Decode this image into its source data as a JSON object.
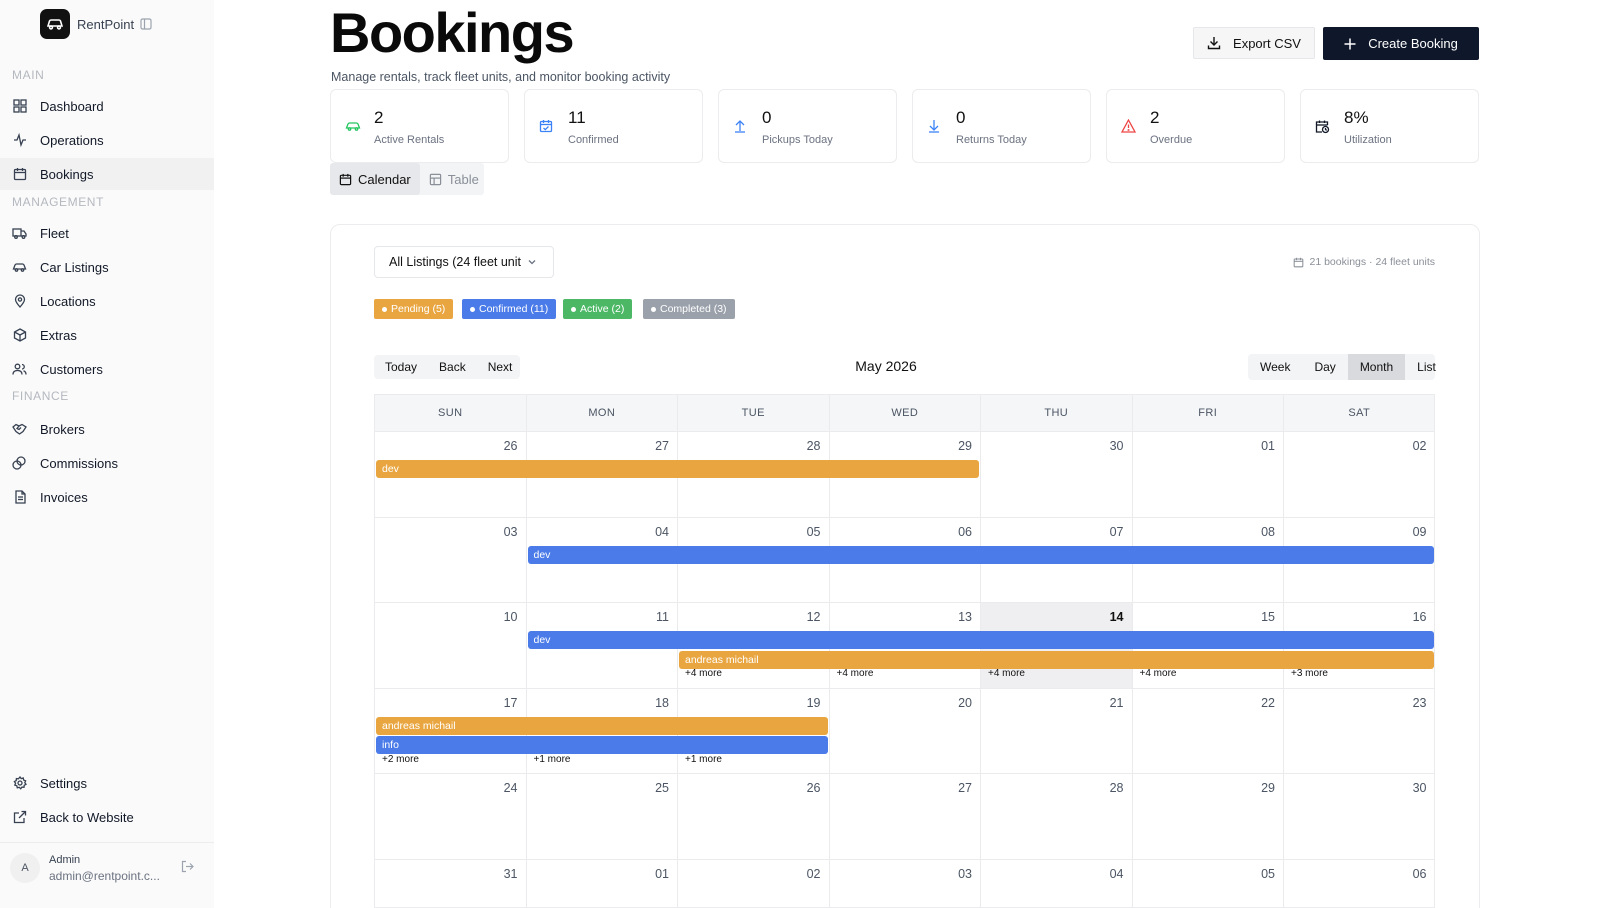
{
  "sidebar": {
    "brand": "RentPoint",
    "sections": {
      "main": "MAIN",
      "management": "MANAGEMENT",
      "finance": "FINANCE"
    },
    "items": [
      {
        "label": "Dashboard",
        "icon": "grid-icon"
      },
      {
        "label": "Operations",
        "icon": "activity-icon"
      },
      {
        "label": "Bookings",
        "icon": "calendar-icon"
      },
      {
        "label": "Fleet",
        "icon": "truck-icon"
      },
      {
        "label": "Car Listings",
        "icon": "car-icon"
      },
      {
        "label": "Locations",
        "icon": "map-pin-icon"
      },
      {
        "label": "Extras",
        "icon": "package-icon"
      },
      {
        "label": "Customers",
        "icon": "users-icon"
      },
      {
        "label": "Brokers",
        "icon": "handshake-icon"
      },
      {
        "label": "Commissions",
        "icon": "coins-icon"
      },
      {
        "label": "Invoices",
        "icon": "file-icon"
      },
      {
        "label": "Settings",
        "icon": "gear-icon"
      },
      {
        "label": "Back to Website",
        "icon": "external-link-icon"
      }
    ],
    "user": {
      "initial": "A",
      "name": "Admin",
      "email": "admin@rentpoint.c..."
    }
  },
  "header": {
    "title": "Bookings",
    "subtitle": "Manage rentals, track fleet units, and monitor booking activity",
    "export_label": "Export CSV",
    "create_label": "Create Booking"
  },
  "stats": [
    {
      "value": "2",
      "label": "Active Rentals",
      "icon": "car-icon",
      "color": "#22c55e"
    },
    {
      "value": "11",
      "label": "Confirmed",
      "icon": "calendar-check-icon",
      "color": "#3b82f6"
    },
    {
      "value": "0",
      "label": "Pickups Today",
      "icon": "arrow-up-icon",
      "color": "#3b82f6"
    },
    {
      "value": "0",
      "label": "Returns Today",
      "icon": "arrow-down-icon",
      "color": "#3b82f6"
    },
    {
      "value": "2",
      "label": "Overdue",
      "icon": "alert-triangle-icon",
      "color": "#ef4444"
    },
    {
      "value": "8%",
      "label": "Utilization",
      "icon": "calendar-clock-icon",
      "color": "#111827"
    }
  ],
  "view_tabs": {
    "calendar": "Calendar",
    "table": "Table",
    "active": "Calendar"
  },
  "calendar": {
    "listing_filter": "All Listings (24 fleet unit",
    "summary": "21 bookings · 24 fleet units",
    "legend": [
      {
        "label": "Pending (5)",
        "color": "#e9a640"
      },
      {
        "label": "Confirmed (11)",
        "color": "#4a7be8"
      },
      {
        "label": "Active (2)",
        "color": "#4cb866"
      },
      {
        "label": "Completed (3)",
        "color": "#9aa1ab"
      }
    ],
    "nav": {
      "today": "Today",
      "back": "Back",
      "next": "Next"
    },
    "month_title": "May 2026",
    "views": [
      "Week",
      "Day",
      "Month",
      "List"
    ],
    "active_view": "Month",
    "weekdays": [
      "SUN",
      "MON",
      "TUE",
      "WED",
      "THU",
      "FRI",
      "SAT"
    ],
    "weeks": [
      {
        "days": [
          "26",
          "27",
          "28",
          "29",
          "30",
          "01",
          "02"
        ],
        "today_index": -1,
        "events": [
          {
            "label": "dev",
            "color": "orange",
            "start": 0,
            "span": 4,
            "lane": 0
          }
        ],
        "more": []
      },
      {
        "days": [
          "03",
          "04",
          "05",
          "06",
          "07",
          "08",
          "09"
        ],
        "today_index": -1,
        "events": [
          {
            "label": "dev",
            "color": "blue",
            "start": 1,
            "span": 6,
            "lane": 0
          }
        ],
        "more": []
      },
      {
        "days": [
          "10",
          "11",
          "12",
          "13",
          "14",
          "15",
          "16"
        ],
        "today_index": 4,
        "events": [
          {
            "label": "dev",
            "color": "blue",
            "start": 1,
            "span": 6,
            "lane": 0
          },
          {
            "label": "andreas michail",
            "color": "orange",
            "start": 2,
            "span": 5,
            "lane": 1
          }
        ],
        "more": [
          {
            "col": 2,
            "label": "+4 more"
          },
          {
            "col": 3,
            "label": "+4 more"
          },
          {
            "col": 4,
            "label": "+4 more"
          },
          {
            "col": 5,
            "label": "+4 more"
          },
          {
            "col": 6,
            "label": "+3 more"
          }
        ]
      },
      {
        "days": [
          "17",
          "18",
          "19",
          "20",
          "21",
          "22",
          "23"
        ],
        "today_index": -1,
        "events": [
          {
            "label": "andreas michail",
            "color": "orange",
            "start": 0,
            "span": 3,
            "lane": 0
          },
          {
            "label": "info",
            "color": "blue",
            "start": 0,
            "span": 3,
            "lane": 1
          }
        ],
        "more": [
          {
            "col": 0,
            "label": "+2 more"
          },
          {
            "col": 1,
            "label": "+1 more"
          },
          {
            "col": 2,
            "label": "+1 more"
          }
        ]
      },
      {
        "days": [
          "24",
          "25",
          "26",
          "27",
          "28",
          "29",
          "30"
        ],
        "today_index": -1,
        "events": [],
        "more": []
      },
      {
        "days": [
          "31",
          "01",
          "02",
          "03",
          "04",
          "05",
          "06"
        ],
        "today_index": -1,
        "events": [],
        "more": []
      }
    ]
  }
}
